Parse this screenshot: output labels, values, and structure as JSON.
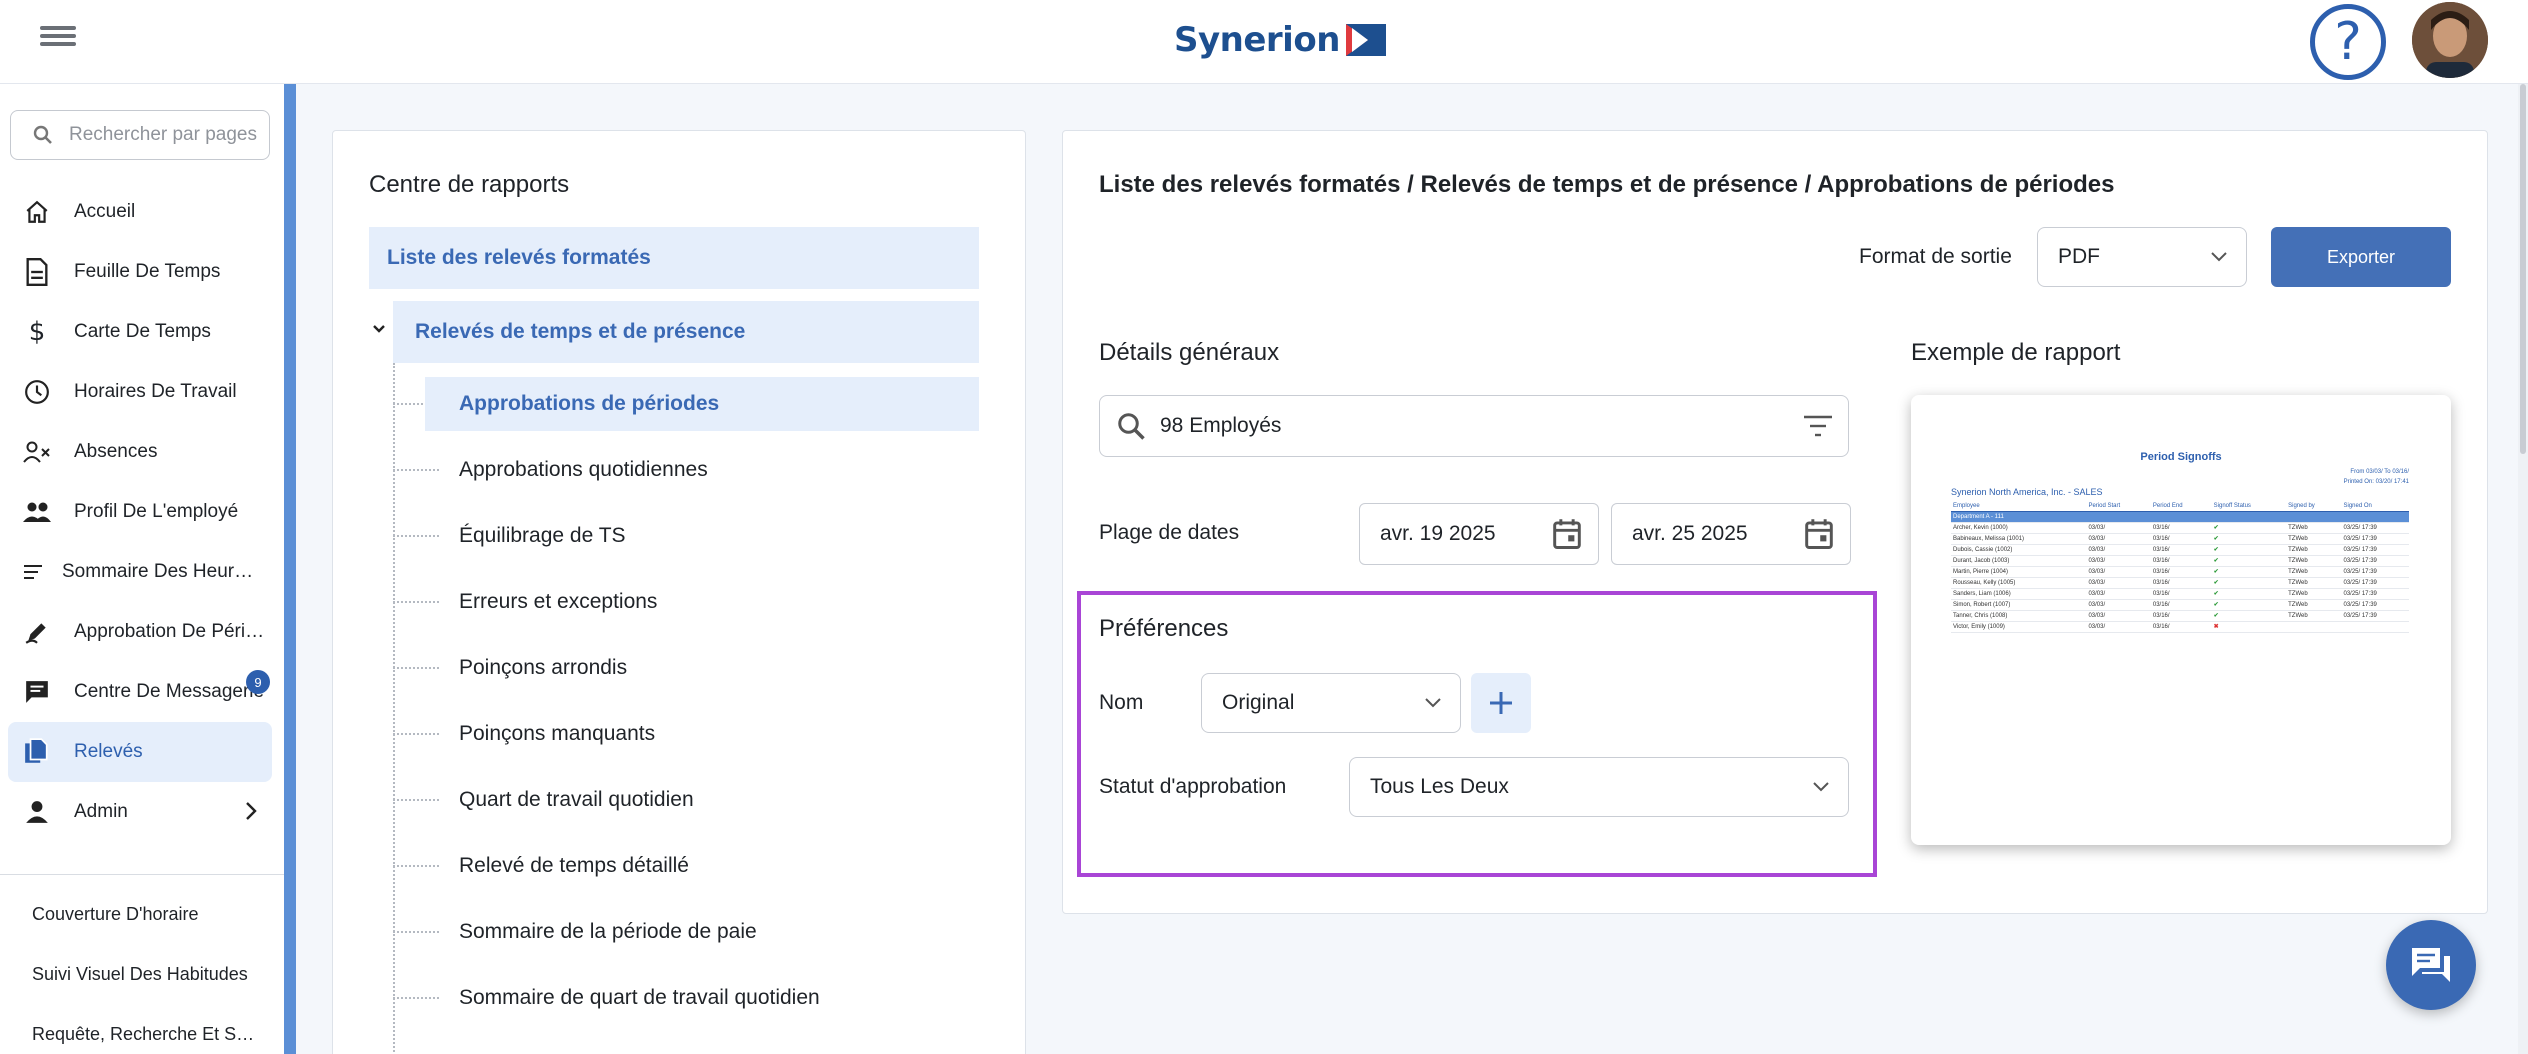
{
  "header": {
    "brand": "Synerion",
    "help_label": "?"
  },
  "sidebar": {
    "search_placeholder": "Rechercher par pages",
    "items": [
      {
        "label": "Accueil",
        "icon": "home-icon"
      },
      {
        "label": "Feuille De Temps",
        "icon": "document-icon"
      },
      {
        "label": "Carte De Temps",
        "icon": "dollar-icon"
      },
      {
        "label": "Horaires De Travail",
        "icon": "clock-icon"
      },
      {
        "label": "Absences",
        "icon": "person-x-icon"
      },
      {
        "label": "Profil De L'employé",
        "icon": "people-icon"
      },
      {
        "label": "Sommaire Des Heures De Travail",
        "icon": "list-icon"
      },
      {
        "label": "Approbation De Périodes",
        "icon": "pen-icon"
      },
      {
        "label": "Centre De Messagerie",
        "icon": "message-icon",
        "badge": "9"
      },
      {
        "label": "Relevés",
        "icon": "copy-icon",
        "active": true
      },
      {
        "label": "Admin",
        "icon": "person-icon"
      }
    ],
    "shortcuts": [
      "Couverture D'horaire",
      "Suivi Visuel Des Habitudes",
      "Requête, Recherche Et Sélection"
    ]
  },
  "reports": {
    "title": "Centre de rapports",
    "root": "Liste des relevés formatés",
    "group": "Relevés de temps et de présence",
    "items": [
      "Approbations de périodes",
      "Approbations quotidiennes",
      "Équilibrage de TS",
      "Erreurs et exceptions",
      "Poinçons arrondis",
      "Poinçons manquants",
      "Quart de travail quotidien",
      "Relevé de temps détaillé",
      "Sommaire de la période de paie",
      "Sommaire de quart de travail quotidien"
    ]
  },
  "detail": {
    "breadcrumb": "Liste des relevés formatés / Relevés de temps et de présence / Approbations de périodes",
    "output_format_label": "Format de sortie",
    "output_format_value": "PDF",
    "export_label": "Exporter",
    "general_title": "Détails généraux",
    "employees_value": "98 Employés",
    "date_range_label": "Plage de dates",
    "date_from": "avr. 19 2025",
    "date_to": "avr. 25 2025",
    "prefs_title": "Préférences",
    "name_label": "Nom",
    "name_value": "Original",
    "status_label": "Statut d'approbation",
    "status_value": "Tous Les Deux",
    "sample_title": "Exemple de rapport",
    "accent_color": "#a945d6"
  },
  "preview": {
    "title": "Period Signoffs",
    "from_line": "From 03/03/ To 03/16/",
    "printed_line": "Printed On: 03/20/ 17:41",
    "company": "Synerion North America, Inc. - SALES",
    "columns": [
      "Employee",
      "Period Start",
      "Period End",
      "Signoff Status",
      "Signed by",
      "Signed On"
    ],
    "department": "Department A - 111",
    "rows": [
      [
        "Archer, Kevin (1000)",
        "03/03/",
        "03/16/",
        "ok",
        "TZWeb",
        "03/25/ 17:39"
      ],
      [
        "Babineaux, Melissa (1001)",
        "03/03/",
        "03/16/",
        "ok",
        "TZWeb",
        "03/25/ 17:39"
      ],
      [
        "Dubois, Cassie (1002)",
        "03/03/",
        "03/16/",
        "ok",
        "TZWeb",
        "03/25/ 17:39"
      ],
      [
        "Durant, Jacob (1003)",
        "03/03/",
        "03/16/",
        "ok",
        "TZWeb",
        "03/25/ 17:39"
      ],
      [
        "Martin, Pierre (1004)",
        "03/03/",
        "03/16/",
        "ok",
        "TZWeb",
        "03/25/ 17:39"
      ],
      [
        "Rousseau, Kelly (1005)",
        "03/03/",
        "03/16/",
        "ok",
        "TZWeb",
        "03/25/ 17:39"
      ],
      [
        "Sanders, Liam (1006)",
        "03/03/",
        "03/16/",
        "ok",
        "TZWeb",
        "03/25/ 17:39"
      ],
      [
        "Simon, Robert (1007)",
        "03/03/",
        "03/16/",
        "ok",
        "TZWeb",
        "03/25/ 17:39"
      ],
      [
        "Tanner, Chris (1008)",
        "03/03/",
        "03/16/",
        "ok",
        "TZWeb",
        "03/25/ 17:39"
      ],
      [
        "Victor, Emily (1009)",
        "03/03/",
        "03/16/",
        "bad",
        "",
        ""
      ]
    ]
  }
}
